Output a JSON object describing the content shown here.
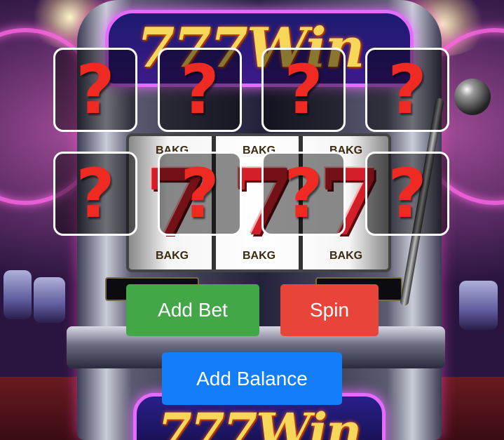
{
  "scene": {
    "brand_top": "777Win",
    "brand_bottom": "777Win",
    "reel_symbol": "7",
    "reel_label": "BAKG"
  },
  "cards": [
    {
      "symbol": "?",
      "state": "hidden"
    },
    {
      "symbol": "?",
      "state": "hidden"
    },
    {
      "symbol": "?",
      "state": "hidden"
    },
    {
      "symbol": "?",
      "state": "hidden"
    },
    {
      "symbol": "?",
      "state": "hidden"
    },
    {
      "symbol": "?",
      "state": "hidden"
    },
    {
      "symbol": "?",
      "state": "hidden"
    },
    {
      "symbol": "?",
      "state": "hidden"
    }
  ],
  "controls": {
    "add_bet_label": "Add Bet",
    "spin_label": "Spin",
    "add_balance_label": "Add Balance"
  },
  "colors": {
    "card_border": "#ffffff",
    "question_mark": "#ee2a22",
    "add_bet": "#43a647",
    "spin": "#e8443a",
    "add_balance": "#137dfa"
  }
}
